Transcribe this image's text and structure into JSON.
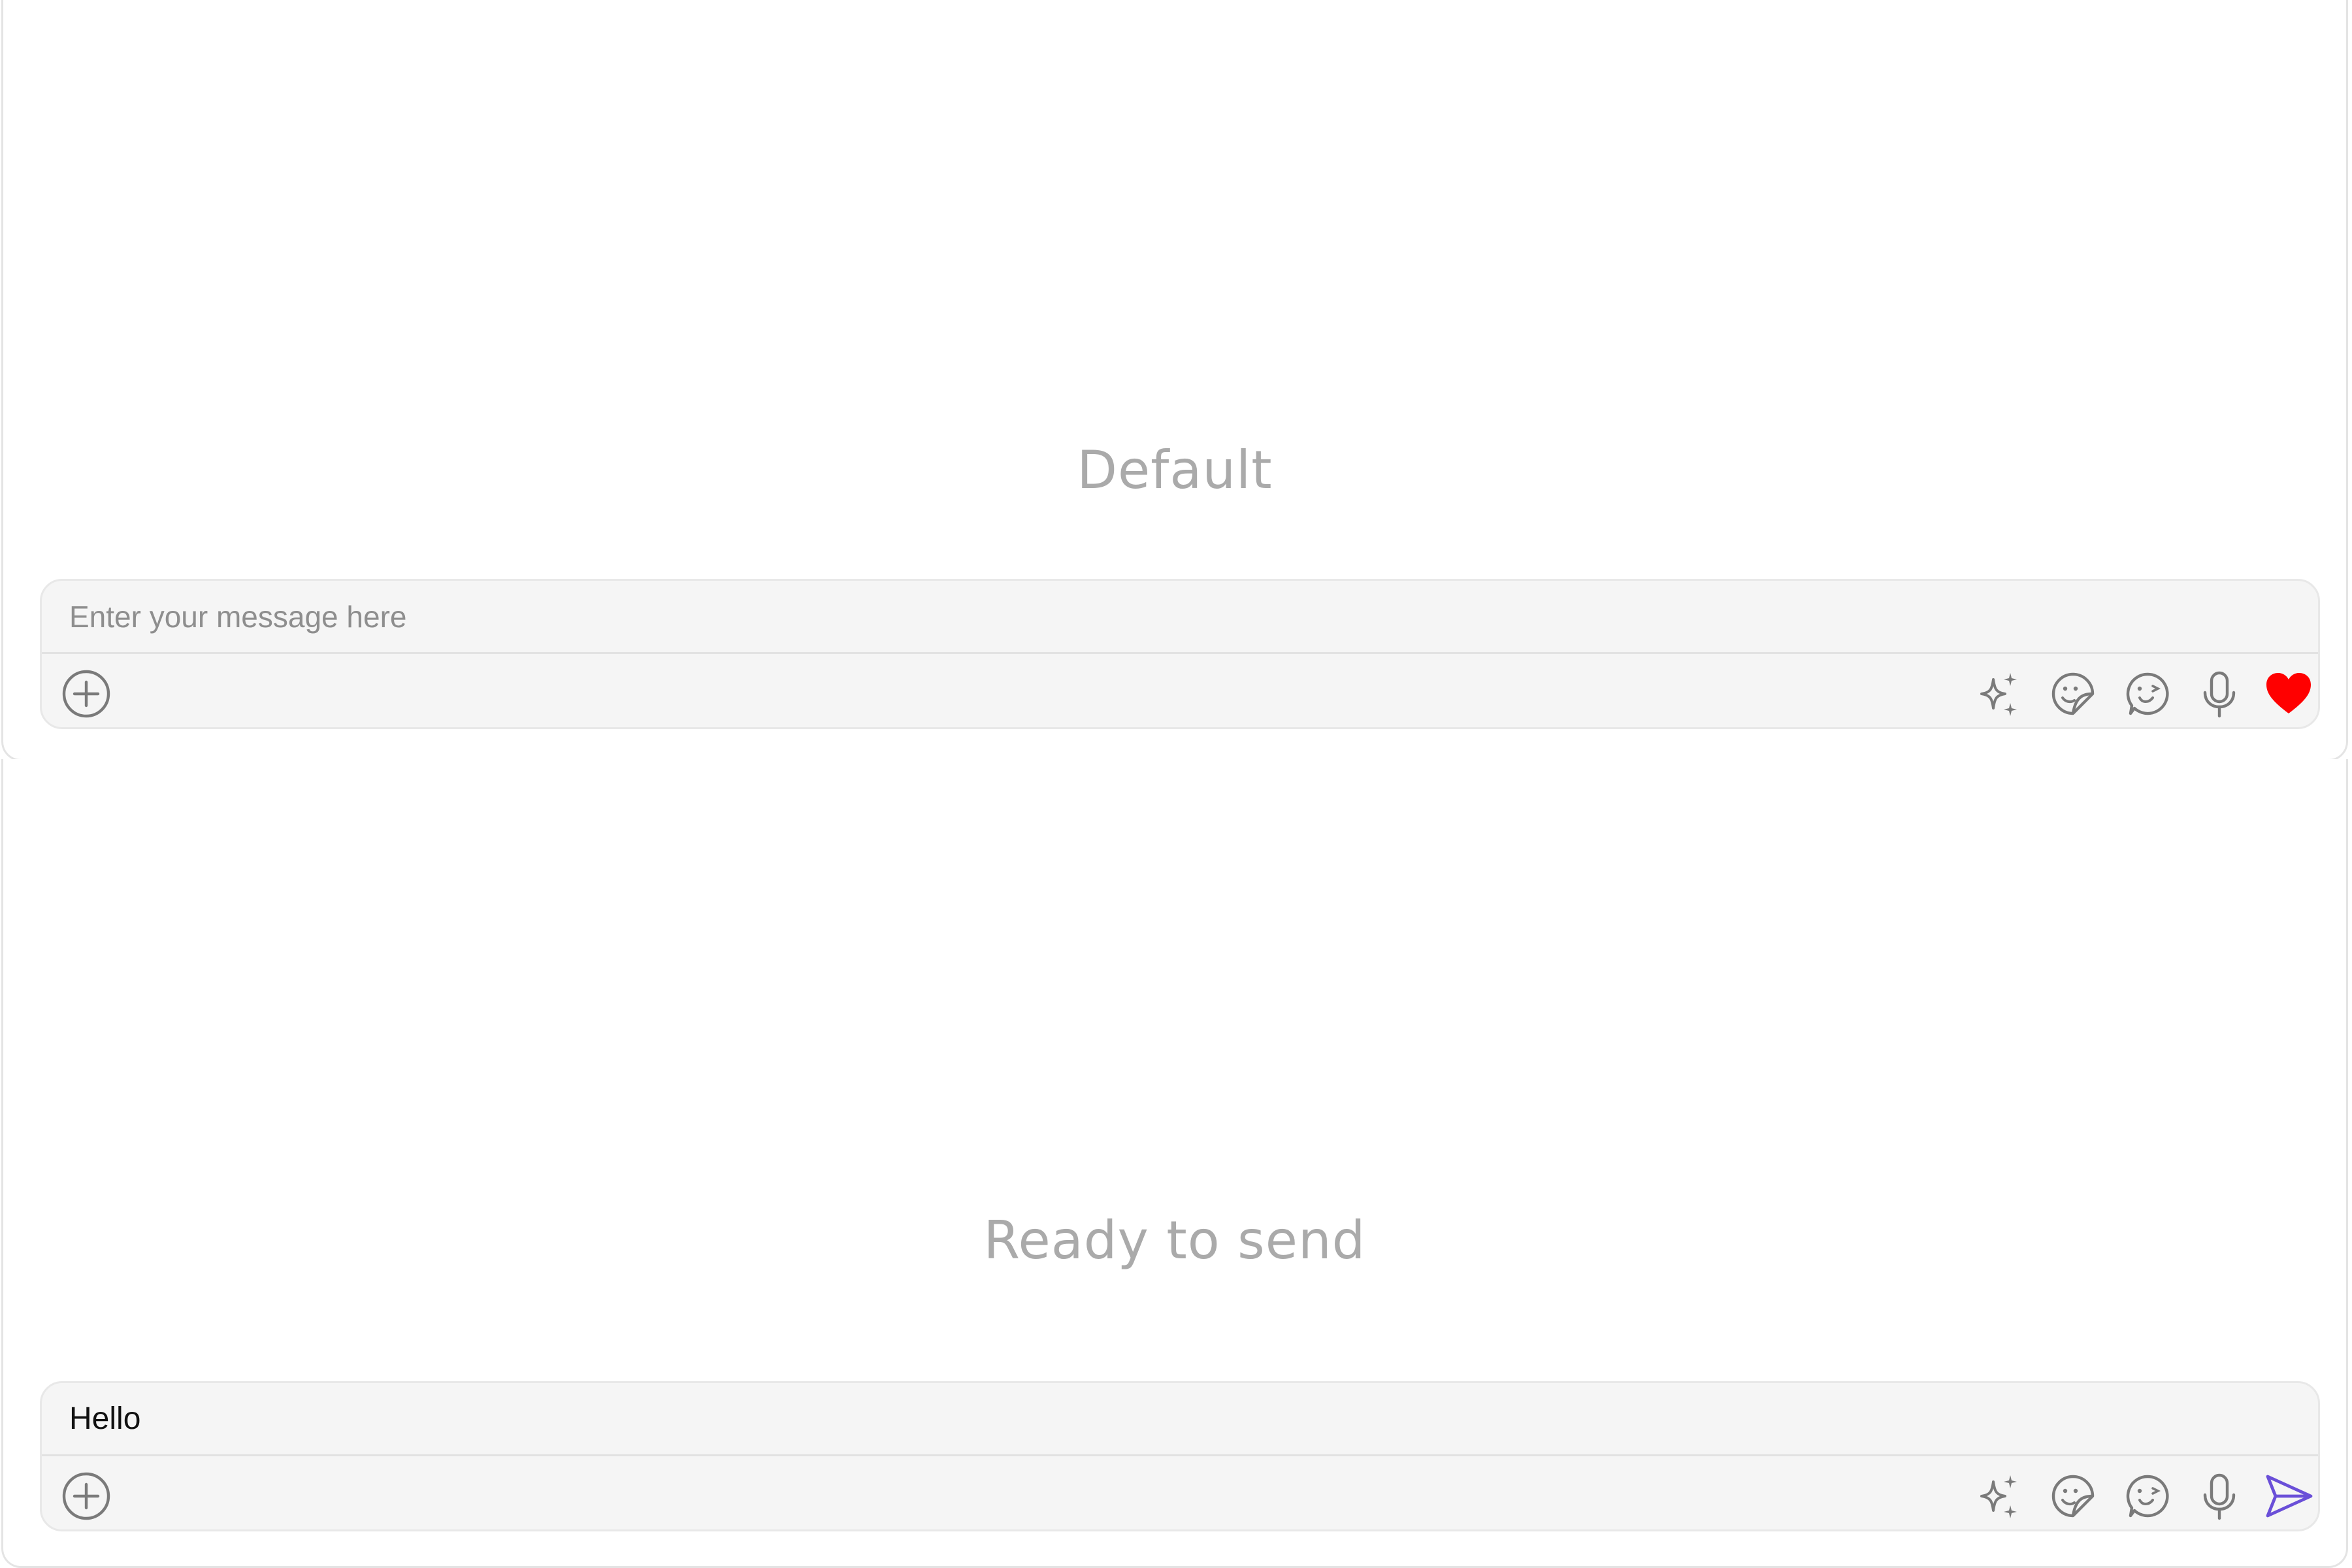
{
  "states": [
    {
      "label": "Default",
      "composer": {
        "placeholder": "Enter your message here",
        "value": "",
        "toolbar_icons": [
          "add-icon",
          "sparkles-icon",
          "sticker-icon",
          "emoji-icon",
          "microphone-icon",
          "heart-icon"
        ],
        "action_icon": "heart-icon",
        "action_color": "#ff0000"
      }
    },
    {
      "label": "Ready to send",
      "composer": {
        "placeholder": "Enter your message here",
        "value": "Hello",
        "toolbar_icons": [
          "add-icon",
          "sparkles-icon",
          "sticker-icon",
          "emoji-icon",
          "microphone-icon",
          "send-icon"
        ],
        "action_icon": "send-icon",
        "action_color": "#6a4fd8"
      }
    }
  ],
  "colors": {
    "icon_gray": "#7a7a7a",
    "heart_red": "#ff0000",
    "send_purple": "#6a4fd8"
  }
}
